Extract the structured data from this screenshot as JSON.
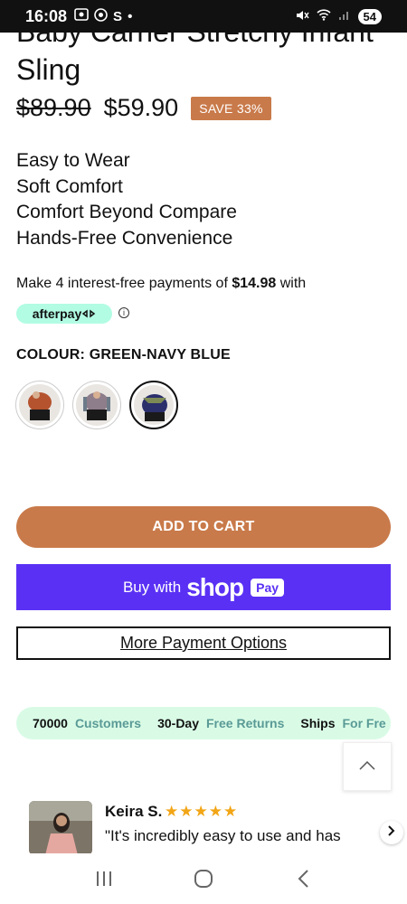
{
  "status_bar": {
    "time": "16:08",
    "carrier_glyph": "S",
    "battery": "54"
  },
  "product": {
    "title": "Baby Carrier Stretchy Infant Sling",
    "old_price": "$89.90",
    "new_price": "$59.90",
    "save_badge": "SAVE 33%",
    "features": [
      "Easy to Wear",
      "Soft Comfort",
      "Comfort Beyond Compare",
      "Hands-Free Convenience"
    ]
  },
  "afterpay": {
    "text_before": "Make 4 interest-free payments of ",
    "amount": "$14.98",
    "text_after": " with",
    "brand": "afterpay"
  },
  "colour": {
    "label": "COLOUR: GREEN-NAVY BLUE",
    "swatches": [
      {
        "name": "rust",
        "color": "#b5532f"
      },
      {
        "name": "mauve-grey",
        "color": "#8e7d8a"
      },
      {
        "name": "green-navy-blue",
        "color": "#2b2f6b"
      }
    ],
    "selected_index": 2
  },
  "buttons": {
    "add_to_cart": "ADD TO CART",
    "buy_with": "Buy with",
    "shop": "shop",
    "pay": "Pay",
    "more_payment": "More Payment Options"
  },
  "trust_bar": {
    "items": [
      {
        "num": "70000",
        "label": "Customers"
      },
      {
        "num": "30-Day",
        "label": "Free Returns"
      },
      {
        "num": "Ships",
        "label": "For Fre"
      }
    ]
  },
  "review": {
    "name": "Keira S.",
    "stars": "★★★★★",
    "text": "\"It's incredibly easy to use and has"
  },
  "colors": {
    "accent": "#c97a4a",
    "shoppay": "#5a31f4",
    "trust_bg": "#d9fbe6",
    "afterpay_bg": "#b2fce4"
  }
}
